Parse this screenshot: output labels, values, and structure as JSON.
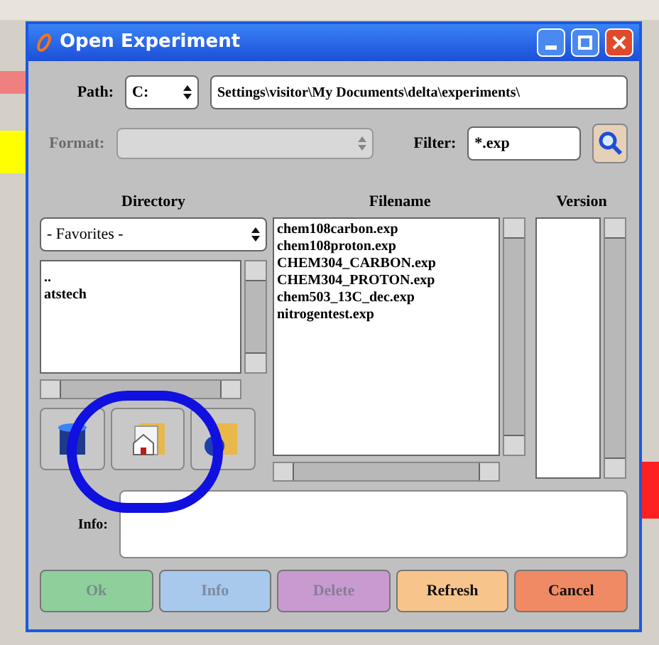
{
  "window": {
    "title": "Open Experiment"
  },
  "path": {
    "label": "Path:",
    "drive": "C:",
    "value": "Settings\\visitor\\My Documents\\delta\\experiments\\"
  },
  "format": {
    "label": "Format:",
    "disabled": true
  },
  "filter": {
    "label": "Filter:",
    "value": "*.exp"
  },
  "directory": {
    "header": "Directory",
    "favorites": "- Favorites -",
    "items": [
      {
        "name": "..",
        "selected": false
      },
      {
        "name": "atstech",
        "selected": false
      }
    ]
  },
  "files": {
    "header": "Filename",
    "items": [
      {
        "name": "chem108carbon.exp",
        "selected": false
      },
      {
        "name": "chem108proton.exp",
        "selected": false
      },
      {
        "name": "CHEM304_CARBON.exp",
        "selected": false
      },
      {
        "name": "CHEM304_PROTON.exp",
        "selected": false
      },
      {
        "name": "chem503_13C_dec.exp",
        "selected": false
      },
      {
        "name": "nitrogentest.exp",
        "selected": false
      }
    ]
  },
  "version": {
    "header": "Version"
  },
  "info": {
    "label": "Info:"
  },
  "buttons": [
    {
      "label": "Ok",
      "color": "#8fcf9c",
      "disabled": true
    },
    {
      "label": "Info",
      "color": "#a8c8ec",
      "disabled": true
    },
    {
      "label": "Delete",
      "color": "#c89ad0",
      "disabled": true
    },
    {
      "label": "Refresh",
      "color": "#f7c48c",
      "disabled": false
    },
    {
      "label": "Cancel",
      "color": "#f08a64",
      "disabled": false
    }
  ]
}
